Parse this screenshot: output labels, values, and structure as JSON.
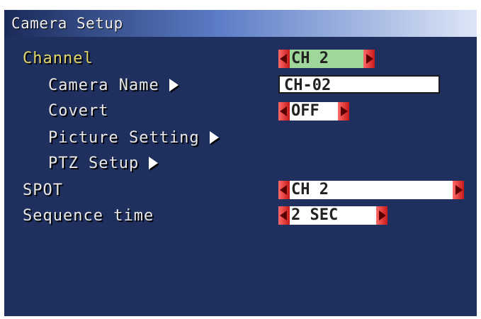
{
  "menu": {
    "title": "Camera Setup",
    "rows": [
      {
        "label": "Channel",
        "value": "CH 2"
      },
      {
        "label": "Camera Name",
        "value": "CH-02"
      },
      {
        "label": "Covert",
        "value": "OFF"
      },
      {
        "label": "Picture Setting"
      },
      {
        "label": "PTZ Setup"
      },
      {
        "label": "SPOT",
        "value": "CH 2"
      },
      {
        "label": "Sequence time",
        "value": "2 SEC"
      }
    ]
  },
  "colors": {
    "background": "#1f2f5e",
    "selected_label": "#e0d66a",
    "selected_value_bg": "#9fd79a",
    "spinner_button": "#e03030"
  },
  "icons": {
    "submenu": "triangle-right-icon",
    "decrement": "triangle-left-icon",
    "increment": "triangle-right-icon"
  }
}
